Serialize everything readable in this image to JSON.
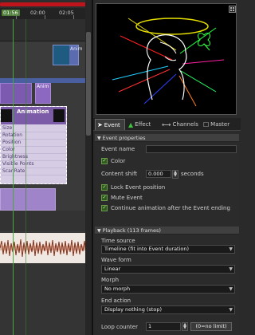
{
  "timeline": {
    "ticks": [
      "01:56",
      "02:00",
      "02:05"
    ],
    "current_tick": "01:56",
    "top_clip_label": "Anim",
    "row2_clip_label": "Anim",
    "animation_clip": {
      "label": "Animation",
      "properties": [
        "Size",
        "Rotation",
        "Position",
        "Color",
        "Brightness",
        "Visible Points",
        "ScanRate"
      ]
    }
  },
  "preview": {
    "menu_icon": "grid-menu-icon"
  },
  "tabs": [
    {
      "label": "Event",
      "icon": "cursor-icon",
      "active": true
    },
    {
      "label": "Effect",
      "icon": "effect-icon",
      "active": false
    },
    {
      "label": "Channels",
      "icon": "channels-icon",
      "active": false
    },
    {
      "label": "Master",
      "icon": "master-icon",
      "active": false
    }
  ],
  "event_properties": {
    "header": "Event properties",
    "event_name_label": "Event name",
    "event_name_value": "",
    "color_label": "Color",
    "content_shift_label": "Content shift",
    "content_shift_value": "0.000",
    "content_shift_unit": "seconds",
    "lock_position_label": "Lock Event position",
    "mute_label": "Mute Event",
    "continue_label": "Continue animation after the Event ending"
  },
  "playback": {
    "header": "Playback (113 frames)",
    "time_source_label": "Time source",
    "time_source_value": "Timeline (fit into Event duration)",
    "wave_form_label": "Wave form",
    "wave_form_value": "Linear",
    "morph_label": "Morph",
    "morph_value": "No morph",
    "end_action_label": "End action",
    "end_action_value": "Display nothing (stop)",
    "loop_counter_label": "Loop counter",
    "loop_counter_value": "1",
    "no_limit_label": "(0=no limit)"
  },
  "colors": {
    "accent_green": "#48a840",
    "purple_clip": "#7c5ba8",
    "timeline_red": "#c0141c"
  }
}
